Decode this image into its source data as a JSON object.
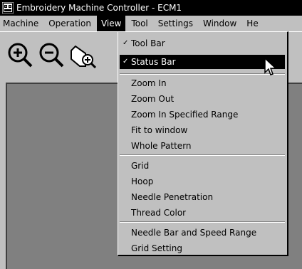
{
  "window": {
    "title": "Embroidery Machine Controller - ECM1"
  },
  "menubar": {
    "items": [
      {
        "id": "machine",
        "label": "Machine"
      },
      {
        "id": "operation",
        "label": "Operation"
      },
      {
        "id": "view",
        "label": "View"
      },
      {
        "id": "tool",
        "label": "Tool"
      },
      {
        "id": "settings",
        "label": "Settings"
      },
      {
        "id": "window",
        "label": "Window"
      },
      {
        "id": "help",
        "label": "He"
      }
    ]
  },
  "toolbar": {
    "buttons": [
      {
        "id": "zoom-in",
        "icon": "zoom-in-icon"
      },
      {
        "id": "zoom-out",
        "icon": "zoom-out-icon"
      },
      {
        "id": "zoom-range",
        "icon": "zoom-range-icon"
      }
    ]
  },
  "view_menu": {
    "items": [
      {
        "label": "Tool Bar",
        "checked": true
      },
      {
        "label": "Status Bar",
        "checked": true,
        "highlighted": true
      },
      {
        "label": "Zoom In"
      },
      {
        "label": "Zoom Out"
      },
      {
        "label": "Zoom In Specified Range"
      },
      {
        "label": "Fit to window"
      },
      {
        "label": "Whole Pattern"
      },
      {
        "label": "Grid"
      },
      {
        "label": "Hoop"
      },
      {
        "label": "Needle Penetration"
      },
      {
        "label": "Thread Color"
      },
      {
        "label": "Needle Bar and Speed Range"
      },
      {
        "label": "Grid Setting"
      }
    ],
    "check_mark": "✓"
  }
}
